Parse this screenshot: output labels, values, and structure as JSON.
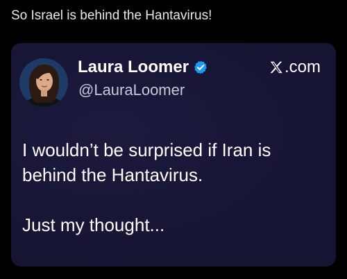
{
  "caption": "So Israel is behind the Hantavirus!",
  "quoted_post": {
    "author_name": "Laura Loomer",
    "author_handle": "@LauraLoomer",
    "verified_icon": "verified-badge-icon",
    "site_icon": "x-logo-icon",
    "site_label": ".com",
    "text_lines": [
      "I wouldn’t be surprised if Iran is",
      "behind the Hantavirus."
    ],
    "closing_line": "Just my thought..."
  },
  "colors": {
    "background": "#000000",
    "card": "#161433",
    "verified_badge": "#1d9bf0",
    "text": "#ffffff"
  }
}
